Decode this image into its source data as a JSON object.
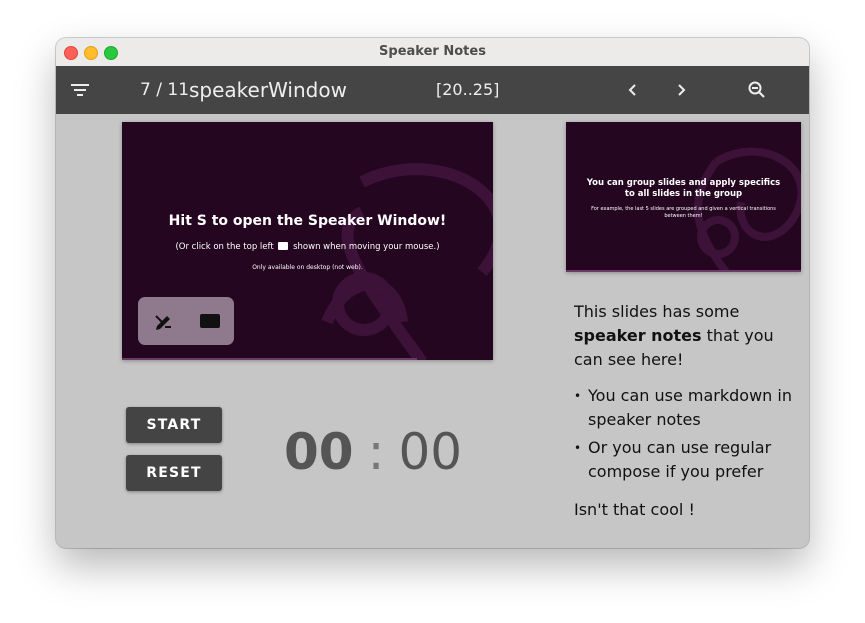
{
  "window": {
    "title": "Speaker Notes"
  },
  "toolbar": {
    "current": "7",
    "total": "11",
    "slide_name": "speakerWindow",
    "range": "[20..25]",
    "icons": [
      "filter-icon",
      "chevron-left-icon",
      "chevron-right-icon",
      "zoom-out-icon"
    ]
  },
  "current_slide": {
    "title": "Hit S to open the Speaker Window!",
    "subtitle_before": "(Or click on the top left",
    "subtitle_after": "shown when moving your mouse.)",
    "small": "Only available on desktop (not web).",
    "tools": [
      "pencil-icon",
      "whiteboard-icon"
    ]
  },
  "next_slide": {
    "title": "You can group slides and apply specifics to all slides in the group",
    "subtitle": "For example, the last 5 slides are grouped and given a vertical transitions between them!"
  },
  "controls": {
    "start_label": "START",
    "reset_label": "RESET"
  },
  "timer": {
    "minutes": "00",
    "separator": ":",
    "seconds": "00"
  },
  "notes": {
    "intro_before": "This slides has some",
    "intro_bold": "speaker notes",
    "intro_after": "that you can see here!",
    "bullets": [
      "You can use markdown in speaker notes",
      "Or you can use regular compose if you prefer"
    ],
    "closing": "Isn't that cool !"
  },
  "colors": {
    "toolbar": "#454545",
    "slide_bg": "#240620",
    "background": "#c6c6c6",
    "button": "#444444"
  }
}
